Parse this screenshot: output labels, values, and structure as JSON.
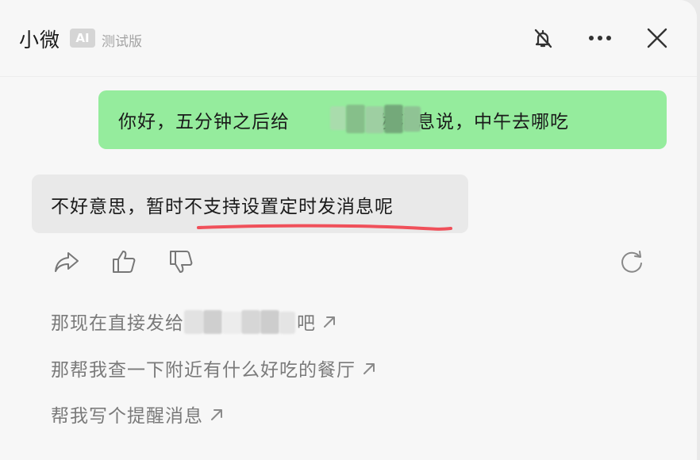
{
  "header": {
    "title": "小微",
    "badge": "AI",
    "beta": "测试版"
  },
  "icons": {
    "mute": "mute-icon",
    "more": "more-icon",
    "close": "close-icon",
    "share": "share-icon",
    "like": "thumbs-up-icon",
    "dislike": "thumbs-down-icon",
    "regenerate": "refresh-icon",
    "suggest_arrow": "arrow-up-right-icon"
  },
  "colors": {
    "user_bubble": "#95ec9d",
    "ai_bubble": "#e9e9e9",
    "highlight_underline": "#f0505a"
  },
  "messages": {
    "user": {
      "prefix": "你好，五分钟之后给",
      "suffix": "发消息说，中午去哪吃"
    },
    "ai": {
      "text": "不好意思，暂时不支持设置定时发消息呢"
    }
  },
  "suggestions": [
    {
      "prefix": "那现在直接发给",
      "suffix": "吧"
    },
    {
      "text": "那帮我查一下附近有什么好吃的餐厅"
    },
    {
      "text": "帮我写个提醒消息"
    }
  ]
}
